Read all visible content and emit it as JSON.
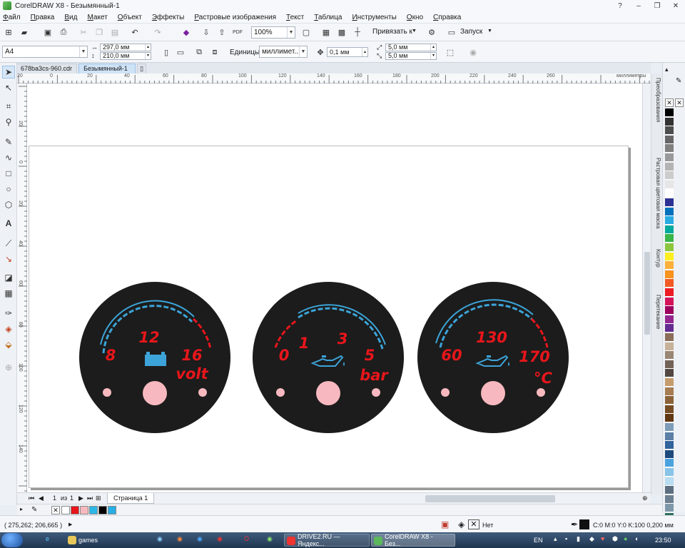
{
  "window": {
    "title": "CorelDRAW X8 - Безымянный-1",
    "buttons": [
      "?",
      "–",
      "❐",
      "✕"
    ]
  },
  "menu": [
    "Файл",
    "Правка",
    "Вид",
    "Макет",
    "Объект",
    "Эффекты",
    "Растровые изображения",
    "Текст",
    "Таблица",
    "Инструменты",
    "Окно",
    "Справка"
  ],
  "toolbar1": {
    "zoom": "100%",
    "snap_label": "Привязать к",
    "launch_label": "Запуск"
  },
  "toolbar2": {
    "page_size": "A4",
    "width": "297,0 мм",
    "height": "210,0 мм",
    "units_label": "Единицы:",
    "units_value": "миллимет...",
    "nudge": "0,1 мм",
    "dup_x": "5,0 мм",
    "dup_y": "5,0 мм"
  },
  "doc_tabs": [
    "678ba3cs-960.cdr",
    "Безымянный-1"
  ],
  "ruler": {
    "unit": "миллиметры",
    "h_ticks": [
      "20",
      "0",
      "20",
      "40",
      "60",
      "80",
      "100",
      "120",
      "140",
      "160",
      "180",
      "200",
      "220",
      "240",
      "260",
      "280"
    ],
    "v_ticks": [
      "20",
      "0",
      "20",
      "40",
      "60",
      "80",
      "100",
      "120",
      "140",
      "160",
      "180"
    ]
  },
  "right_panels": [
    "Преобразования",
    "Растровая цветовая маска",
    "Контур",
    "Перетекание"
  ],
  "gauges": [
    {
      "name": "voltmeter",
      "labels": {
        "left": "8",
        "center": "12",
        "right": "16"
      },
      "unit": "volt",
      "icon": "battery-icon"
    },
    {
      "name": "oil-pressure",
      "labels": {
        "left": "0",
        "left2": "1",
        "center": "3",
        "right": "5"
      },
      "unit": "bar",
      "icon": "oil-can-icon"
    },
    {
      "name": "oil-temperature",
      "labels": {
        "left": "60",
        "center": "130",
        "right": "170"
      },
      "unit": "°C",
      "icon": "oil-can-icon"
    }
  ],
  "colors": {
    "gauge_face": "#1c1c1c",
    "scale_blue": "#3ca4d8",
    "scale_red": "#e8161b",
    "knob_pink": "#f7b9bf"
  },
  "page_nav": {
    "current": "1",
    "of_label": "из",
    "total": "1",
    "page_tab": "Страница 1"
  },
  "document_palette": [
    "#ffffff",
    "#e8161b",
    "#f7b9bf",
    "#2bb8e6",
    "#000000",
    "#26aee6"
  ],
  "status": {
    "coords": "( 275,262; 206,665 )",
    "fill_label": "Нет",
    "outline": "C:0 M:0 Y:0 K:100  0,200 мм"
  },
  "taskbar": {
    "items": [
      "games",
      "DRIVE2.RU — Яндекс...",
      "CorelDRAW X8 - Без..."
    ],
    "lang": "EN",
    "time": "23:50"
  }
}
